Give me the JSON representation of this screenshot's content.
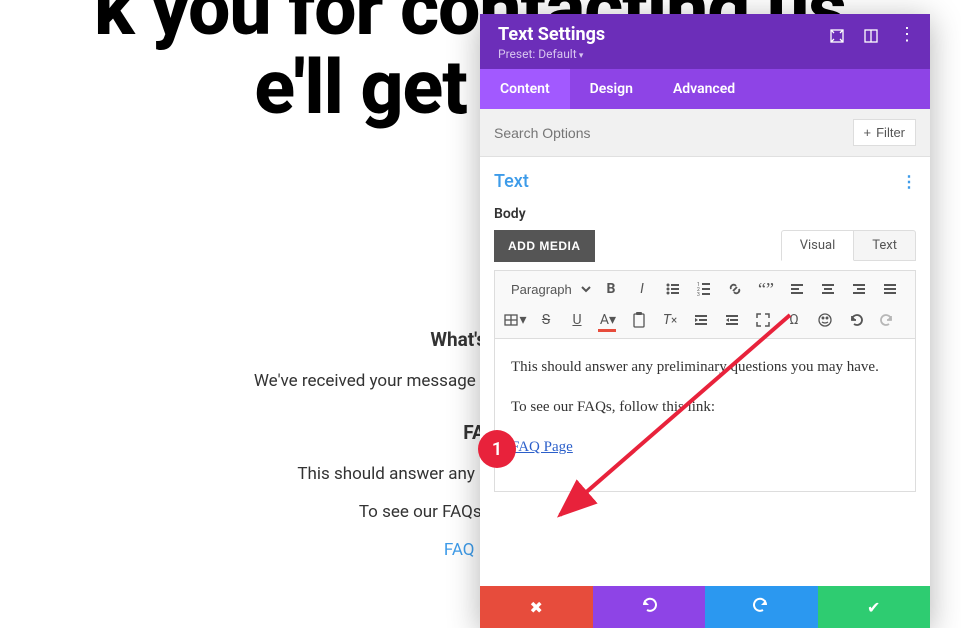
{
  "hero": {
    "line1": "k you for contacting us.",
    "line2": "e'll get in touc"
  },
  "page": {
    "whats_next_heading": "What's Next",
    "whats_next_text": "We've received your message and we'll send you an email wi",
    "faq_heading": "FAQ",
    "faq_text1": "This should answer any preliminary questions yo",
    "faq_text2": "To see our FAQs, follow this link:",
    "faq_link": "FAQ Page"
  },
  "panel": {
    "title": "Text Settings",
    "preset": "Preset: Default",
    "tabs": {
      "content": "Content",
      "design": "Design",
      "advanced": "Advanced"
    },
    "search_placeholder": "Search Options",
    "filter": "Filter",
    "section_title": "Text",
    "body_label": "Body",
    "add_media": "ADD MEDIA",
    "editor_tabs": {
      "visual": "Visual",
      "text": "Text"
    },
    "paragraph_select": "Paragraph",
    "editor": {
      "p1": "This should answer any preliminary questions you may have.",
      "p2": "To see our FAQs, follow this link:",
      "link": "FAQ Page"
    }
  },
  "annotation": {
    "number": "1"
  }
}
